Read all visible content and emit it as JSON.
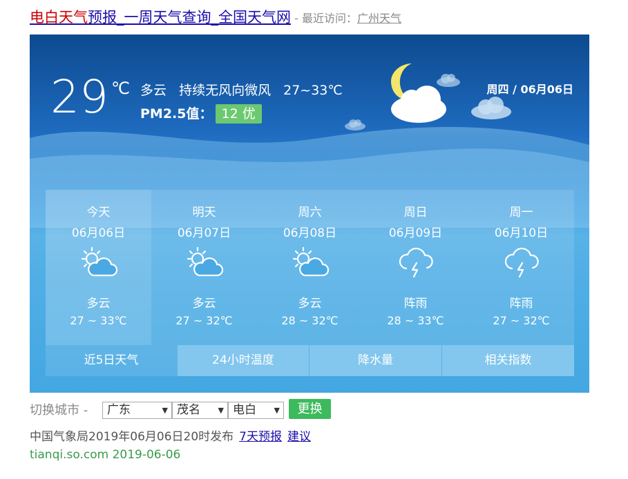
{
  "header": {
    "title_highlight": "电白天气",
    "title_rest": "预报_一周天气查询_全国天气网",
    "recent_prefix": " - 最近访问：",
    "recent_link": "广州天气"
  },
  "current": {
    "temp": "29",
    "unit": "℃",
    "condition": "多云",
    "wind": "持续无风向微风",
    "range": "27~33℃",
    "pm_label": "PM2.5值：",
    "aqi": "12 优",
    "date": "周四 / 06月06日"
  },
  "forecast": [
    {
      "name": "今天",
      "date": "06月06日",
      "weather": "多云",
      "range": "27 ~ 33℃",
      "icon": "partly-cloudy-icon"
    },
    {
      "name": "明天",
      "date": "06月07日",
      "weather": "多云",
      "range": "27 ~ 32℃",
      "icon": "partly-cloudy-icon"
    },
    {
      "name": "周六",
      "date": "06月08日",
      "weather": "多云",
      "range": "28 ~ 32℃",
      "icon": "partly-cloudy-icon"
    },
    {
      "name": "周日",
      "date": "06月09日",
      "weather": "阵雨",
      "range": "28 ~ 33℃",
      "icon": "thunder-shower-icon"
    },
    {
      "name": "周一",
      "date": "06月10日",
      "weather": "阵雨",
      "range": "27 ~ 32℃",
      "icon": "thunder-shower-icon"
    }
  ],
  "tabs": [
    "近5日天气",
    "24小时温度",
    "降水量",
    "相关指数"
  ],
  "switch": {
    "label": "切换城市 -",
    "province": "广东",
    "city": "茂名",
    "district": "电白",
    "button": "更换"
  },
  "footer": {
    "published": "中国气象局2019年06月06日20时发布",
    "link_7day": "7天预报",
    "link_suggest": "建议",
    "url": "tianqi.so.com 2019-06-06"
  },
  "colors": {
    "aqi_good": "#6cc970",
    "go_button": "#3cba5d",
    "link": "#1a0dab",
    "highlight": "#cc0000"
  }
}
